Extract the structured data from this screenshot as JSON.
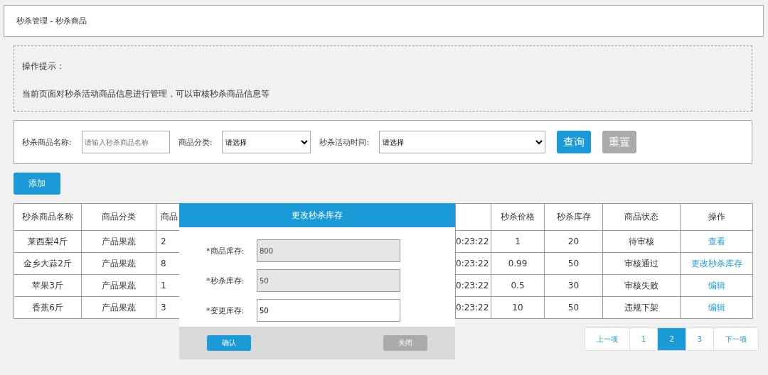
{
  "breadcrumb": "秒杀管理 - 秒杀商品",
  "tips": {
    "title": "操作提示：",
    "text": "当前页面对秒杀活动商品信息进行管理，可以审核秒杀商品信息等"
  },
  "filters": [
    {
      "label": "秒杀商品名称:",
      "kind": "text",
      "placeholder": "请输入秒杀商品名称"
    },
    {
      "label": "商品分类:",
      "kind": "select",
      "value": "请选择"
    },
    {
      "label": "秒杀活动时间:",
      "kind": "select",
      "value": "请选择",
      "wide": true
    }
  ],
  "filter_buttons": [
    {
      "label": "查询",
      "kind": "primary"
    },
    {
      "label": "重置",
      "kind": "secondary"
    }
  ],
  "add_button": "添加",
  "table": {
    "columns": [
      "秒杀商品名称",
      "商品分类",
      "商品",
      "",
      "",
      "秒杀价格",
      "秒杀库存",
      "商品状态",
      "操作"
    ],
    "rows": [
      {
        "cells": [
          "莱西梨4斤",
          "产品果蔬",
          "2",
          "",
          "0:23:22",
          "1",
          "20",
          "待审核"
        ],
        "action": "查看"
      },
      {
        "cells": [
          "金乡大蒜2斤",
          "产品果蔬",
          "8",
          "",
          "0:23:22",
          "0.99",
          "50",
          "审核通过"
        ],
        "action": "更改秒杀库存"
      },
      {
        "cells": [
          "苹果3斤",
          "产品果蔬",
          "1",
          "",
          "0:23:22",
          "0.5",
          "30",
          "审核失败"
        ],
        "action": "编辑"
      },
      {
        "cells": [
          "香蕉6斤",
          "产品果蔬",
          "3",
          "",
          "0:23:22",
          "10",
          "50",
          "违规下架"
        ],
        "action": "编辑"
      }
    ]
  },
  "pagination": [
    {
      "label": "上一项",
      "selected": false
    },
    {
      "label": "1",
      "selected": false
    },
    {
      "label": "2",
      "selected": true
    },
    {
      "label": "3",
      "selected": false
    },
    {
      "label": "下一项",
      "selected": false
    }
  ],
  "dialog": {
    "title": "更改秒杀库存",
    "fields": [
      {
        "label": "*商品库存:",
        "value": "800",
        "readonly": true
      },
      {
        "label": "*秒杀库存:",
        "value": "50",
        "readonly": true
      },
      {
        "label": "*变更库存:",
        "value": "50",
        "readonly": false
      }
    ],
    "buttons": [
      {
        "label": "确认",
        "kind": "primary"
      },
      {
        "label": "关闭",
        "kind": "secondary"
      }
    ]
  }
}
